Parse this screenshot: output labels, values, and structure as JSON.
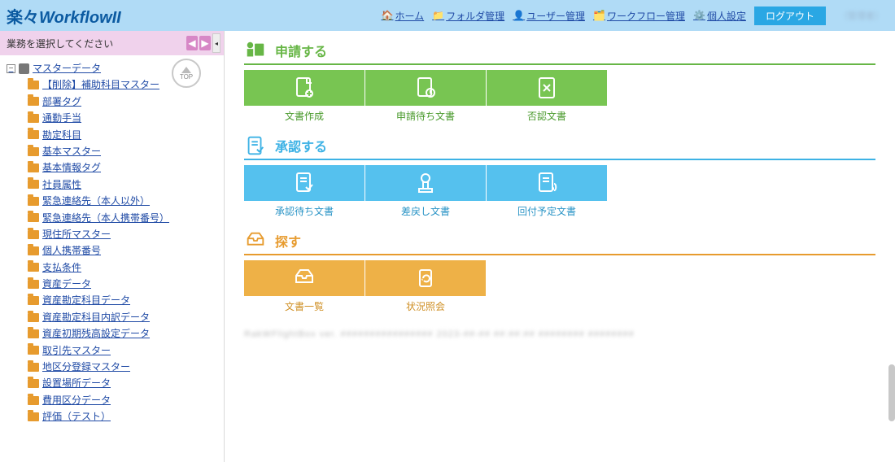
{
  "header": {
    "logo_prefix": "楽々",
    "logo_main": "WorkflowII",
    "nav": [
      {
        "label": "ホーム",
        "icon": "home-icon"
      },
      {
        "label": "フォルダ管理",
        "icon": "folder-icon"
      },
      {
        "label": "ユーザー管理",
        "icon": "user-icon"
      },
      {
        "label": "ワークフロー管理",
        "icon": "workflow-icon"
      },
      {
        "label": "個人設定",
        "icon": "gear-icon"
      }
    ],
    "logout": "ログアウト",
    "username": "（管理者）"
  },
  "sidebar": {
    "prompt": "業務を選択してください",
    "top_label": "TOP",
    "root": "マスターデータ",
    "items": [
      "【削除】補助科目マスター",
      "部署タグ",
      "通勤手当",
      "勘定科目",
      "基本マスター",
      "基本情報タグ",
      "社員属性",
      "緊急連絡先（本人以外）",
      "緊急連絡先（本人携帯番号）",
      "現住所マスター",
      "個人携帯番号",
      "支払条件",
      "資産データ",
      "資産勘定科目データ",
      "資産勘定科目内訳データ",
      "資産初期残高設定データ",
      "取引先マスター",
      "地区分登録マスター",
      "設置場所データ",
      "費用区分データ",
      "評価（テスト）"
    ]
  },
  "sections": [
    {
      "key": "apply",
      "title": "申請する",
      "theme": "green",
      "tiles": [
        {
          "label": "文書作成",
          "icon": "doc-plus-icon"
        },
        {
          "label": "申請待ち文書",
          "icon": "doc-clock-icon"
        },
        {
          "label": "否認文書",
          "icon": "doc-x-icon"
        }
      ]
    },
    {
      "key": "approve",
      "title": "承認する",
      "theme": "blue",
      "tiles": [
        {
          "label": "承認待ち文書",
          "icon": "doc-check-icon"
        },
        {
          "label": "差戻し文書",
          "icon": "stamp-icon"
        },
        {
          "label": "回付予定文書",
          "icon": "doc-route-icon"
        }
      ]
    },
    {
      "key": "search",
      "title": "探す",
      "theme": "orange",
      "tiles": [
        {
          "label": "文書一覧",
          "icon": "tray-icon"
        },
        {
          "label": "状況照会",
          "icon": "refresh-doc-icon"
        }
      ]
    }
  ],
  "footer_text": "RakWFlightBox ver.  ################  2023-##-##  ##:##:##  ########  ########"
}
